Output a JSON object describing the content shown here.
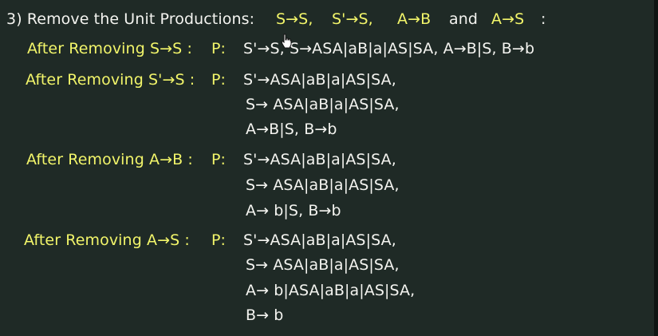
{
  "title": {
    "label": "3) Remove the Unit Productions:",
    "items": [
      "S→S,",
      "S'→S,",
      "A→B",
      "and",
      "A→S",
      ":"
    ]
  },
  "steps": [
    {
      "heading": "After Removing S→S :",
      "p": "P:",
      "lines": [
        "S'→S,  S→ASA|aB|a|AS|SA,  A→B|S,  B→b"
      ]
    },
    {
      "heading": "After Removing S'→S :",
      "p": "P:",
      "lines": [
        "S'→ASA|aB|a|AS|SA,",
        "S→ ASA|aB|a|AS|SA,",
        "A→B|S,  B→b"
      ]
    },
    {
      "heading": "After Removing A→B :",
      "p": "P:",
      "lines": [
        "S'→ASA|aB|a|AS|SA,",
        "S→ ASA|aB|a|AS|SA,",
        "A→ b|S,  B→b"
      ]
    },
    {
      "heading": "After Removing A→S :",
      "p": "P:",
      "lines": [
        "S'→ASA|aB|a|AS|SA,",
        "S→ ASA|aB|a|AS|SA,",
        "A→ b|ASA|aB|a|AS|SA,",
        "B→ b"
      ]
    }
  ],
  "colors": {
    "background": "#1f2a26",
    "text_white": "#f4f4f0",
    "text_yellow": "#f2f56a"
  }
}
